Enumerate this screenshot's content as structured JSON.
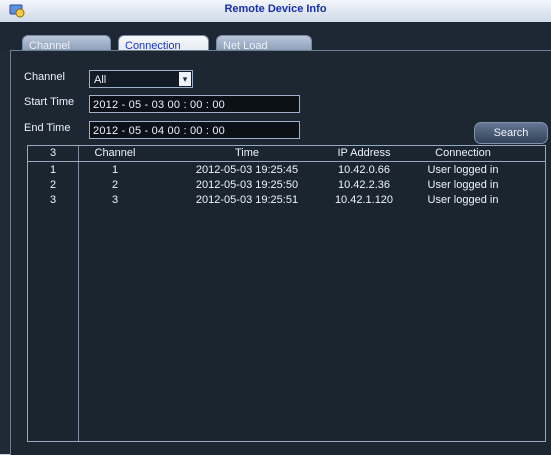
{
  "window": {
    "title": "Remote Device Info"
  },
  "tabs": [
    {
      "label": "Channel Status"
    },
    {
      "label": "Connection Log"
    },
    {
      "label": "Net Load"
    }
  ],
  "filters": {
    "channel_label": "Channel",
    "channel_value": "All",
    "start_label": "Start Time",
    "start_value": "2012 - 05 - 03   00 : 00 : 00",
    "end_label": "End Time",
    "end_value": "2012 - 05 - 04   00 : 00 : 00",
    "search_label": "Search"
  },
  "table": {
    "headers": [
      "3",
      "Channel",
      "Time",
      "IP Address",
      "Connection"
    ],
    "rows": [
      [
        "1",
        "1",
        "2012-05-03 19:25:45",
        "10.42.0.66",
        "User logged in"
      ],
      [
        "2",
        "2",
        "2012-05-03 19:25:50",
        "10.42.2.36",
        "User logged in"
      ],
      [
        "3",
        "3",
        "2012-05-03 19:25:51",
        "10.42.1.120",
        "User logged in"
      ]
    ]
  }
}
